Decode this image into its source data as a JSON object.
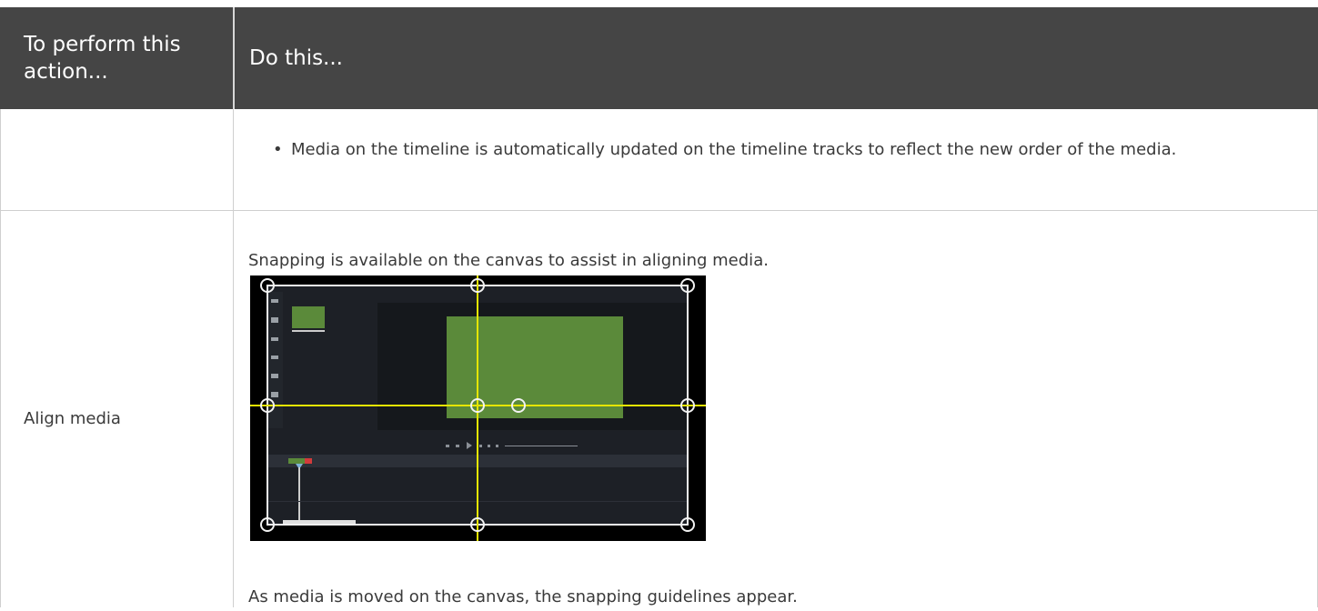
{
  "table": {
    "header": {
      "col1": "To perform this action...",
      "col2": "Do this..."
    },
    "rows": [
      {
        "action": "",
        "bullet": "Media on the timeline is automatically updated on the timeline tracks to reflect the new order of the media."
      },
      {
        "action": "Align media",
        "intro": "Snapping is available on the canvas to assist in aligning media.",
        "outro": "As media is moved on the canvas, the snapping guidelines appear."
      }
    ]
  },
  "screenshot": {
    "description_icon": "snapping-guidelines-screenshot",
    "colors": {
      "background": "#1d2026",
      "panel": "#262a31",
      "media": "#5b8a3a",
      "guideline": "#e6e600",
      "border": "#f2f2f2"
    }
  }
}
